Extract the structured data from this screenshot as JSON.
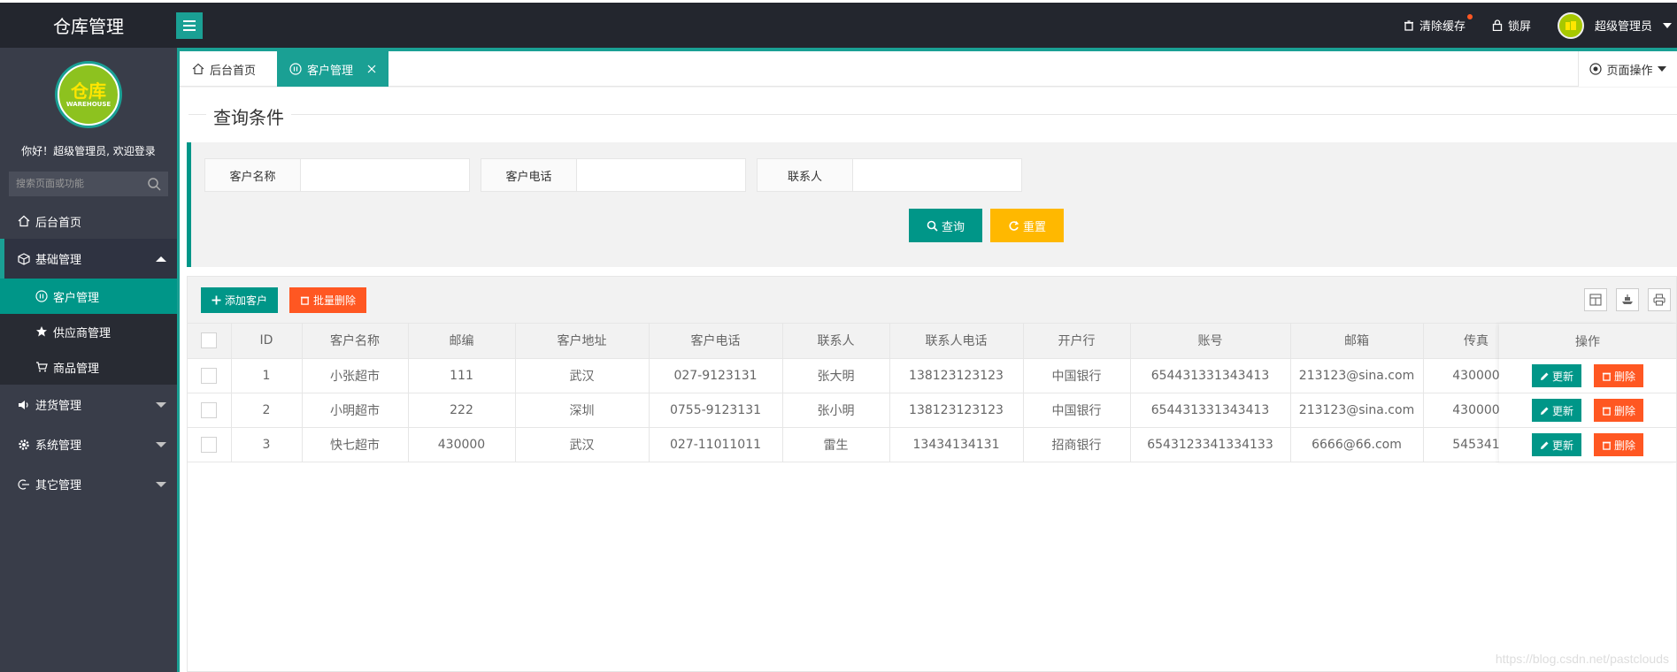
{
  "app": {
    "title": "仓库管理"
  },
  "header": {
    "clear_cache": "清除缓存",
    "lock_screen": "锁屏",
    "user_name": "超级管理员"
  },
  "sidebar": {
    "avatar_text_big": "仓库",
    "avatar_text_small": "WAREHOUSE",
    "welcome": "你好！超级管理员, 欢迎登录",
    "search_placeholder": "搜索页面或功能",
    "items": [
      {
        "label": "后台首页"
      },
      {
        "label": "基础管理"
      },
      {
        "label": "进货管理"
      },
      {
        "label": "系统管理"
      },
      {
        "label": "其它管理"
      }
    ],
    "sub_items": [
      {
        "label": "客户管理"
      },
      {
        "label": "供应商管理"
      },
      {
        "label": "商品管理"
      }
    ]
  },
  "tabs": [
    {
      "label": "后台首页"
    },
    {
      "label": "客户管理"
    }
  ],
  "page_ops": "页面操作",
  "query": {
    "title": "查询条件",
    "fields": [
      {
        "label": "客户名称",
        "value": ""
      },
      {
        "label": "客户电话",
        "value": ""
      },
      {
        "label": "联系人",
        "value": ""
      }
    ],
    "search_button": "查询",
    "reset_button": "重置"
  },
  "toolbar": {
    "add_button": "添加客户",
    "batch_delete_button": "批量删除"
  },
  "table": {
    "columns": [
      "ID",
      "客户名称",
      "邮编",
      "客户地址",
      "客户电话",
      "联系人",
      "联系人电话",
      "开户行",
      "账号",
      "邮箱",
      "传真",
      "操作"
    ],
    "rows": [
      [
        "1",
        "小张超市",
        "111",
        "武汉",
        "027-9123131",
        "张大明",
        "138123123123",
        "中国银行",
        "654431331343413",
        "213123@sina.com",
        "430000"
      ],
      [
        "2",
        "小明超市",
        "222",
        "深圳",
        "0755-9123131",
        "张小明",
        "138123123123",
        "中国银行",
        "654431331343413",
        "213123@sina.com",
        "430000"
      ],
      [
        "3",
        "快七超市",
        "430000",
        "武汉",
        "027-11011011",
        "雷生",
        "13434134131",
        "招商银行",
        "6543123341334133",
        "6666@66.com",
        "545341"
      ]
    ],
    "edit_label": "更新",
    "delete_label": "删除"
  },
  "watermark": "https://blog.csdn.net/pastclouds",
  "colors": {
    "accent": "#009688",
    "warn": "#ffb800",
    "danger": "#ff5722",
    "dark": "#23262e",
    "sidebar": "#393d49"
  }
}
